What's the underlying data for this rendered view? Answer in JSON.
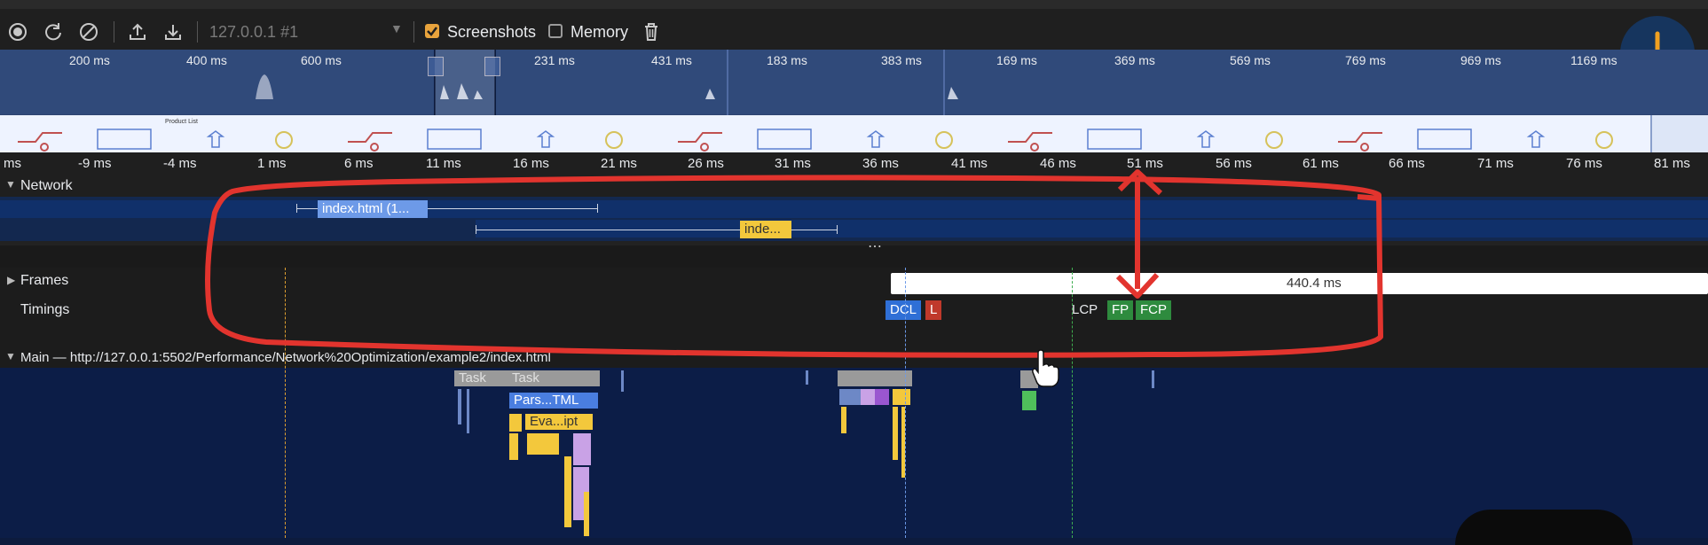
{
  "toolbar": {
    "target": "127.0.0.1 #1",
    "screenshots_label": "Screenshots",
    "memory_label": "Memory",
    "icons": [
      "record-icon",
      "reload-icon",
      "clear-icon",
      "upload-icon",
      "download-icon",
      "dropdown-icon",
      "delete-icon"
    ]
  },
  "overview": {
    "labels": [
      "200 ms",
      "400 ms",
      "600 ms",
      "231 ms",
      "431 ms",
      "183 ms",
      "383 ms",
      "169 ms",
      "369 ms",
      "569 ms",
      "769 ms",
      "969 ms",
      "1169 ms"
    ],
    "screenshot_title": "Product List"
  },
  "ruler": {
    "labels": [
      "ms",
      "-9 ms",
      "-4 ms",
      "1 ms",
      "6 ms",
      "11 ms",
      "16 ms",
      "21 ms",
      "26 ms",
      "31 ms",
      "36 ms",
      "41 ms",
      "46 ms",
      "51 ms",
      "56 ms",
      "61 ms",
      "66 ms",
      "71 ms",
      "76 ms",
      "81 ms"
    ]
  },
  "network": {
    "title": "Network",
    "requests": [
      "index.html (1...",
      "inde..."
    ]
  },
  "frames": {
    "title": "Frames",
    "duration": "440.4 ms"
  },
  "timings": {
    "title": "Timings",
    "markers": [
      "DCL",
      "L",
      "LCP",
      "FP",
      "FCP"
    ]
  },
  "main": {
    "title": "Main — http://127.0.0.1:5502/Performance/Network%20Optimization/example2/index.html",
    "tasks": [
      "Task",
      "Task",
      "Pars...TML",
      "Eva...ipt"
    ]
  },
  "colors": {
    "accent": "#e2342e",
    "dcl": "#2f6fd6",
    "load": "#c0392b",
    "fp": "#2e8b3e",
    "fcp": "#2e8b3e",
    "parse": "#4a7ee0",
    "script": "#f3c83c"
  }
}
